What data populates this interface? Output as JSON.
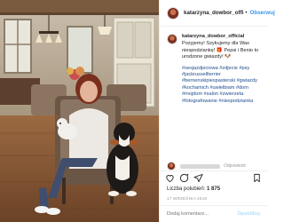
{
  "post": {
    "header": {
      "username": "katarzyna_dowbor_offi",
      "separator": "•",
      "follow_label": "Obserwuj"
    },
    "caption": {
      "username": "katarzyna_dowbor_official",
      "text": "Pozyjemy! Szykujemy dla Was niespodziankę! 🎁 Pepsi i Benio to urodzone gwiazdy! 🐶",
      "hashtags": [
        "#sesjazdjeciowa #zdjecie #psy",
        "#jackrussellterrier",
        "#bernenskipiespasterski #gwiazdy",
        "#kochamich #uwielbiam #dom",
        "#mojdom #salon #zwierzeta",
        "#fotografowanie #niespodzianka"
      ]
    },
    "reply_label": "Odpowiedz",
    "likes": {
      "prefix": "Liczba polubień: ",
      "count": "1 875"
    },
    "date": "17 WRZEŚNIA 2018",
    "add_comment": {
      "placeholder": "Dodaj komentarz...",
      "publish_label": "Opublikuj"
    }
  },
  "icons": {
    "like": "heart-icon",
    "comment": "comment-icon",
    "share": "share-icon",
    "save": "bookmark-icon",
    "more": "more-icon"
  },
  "colors": {
    "link": "#3897f0",
    "hashtag": "#1c4b8c",
    "muted": "#999999",
    "border": "#efefef"
  }
}
